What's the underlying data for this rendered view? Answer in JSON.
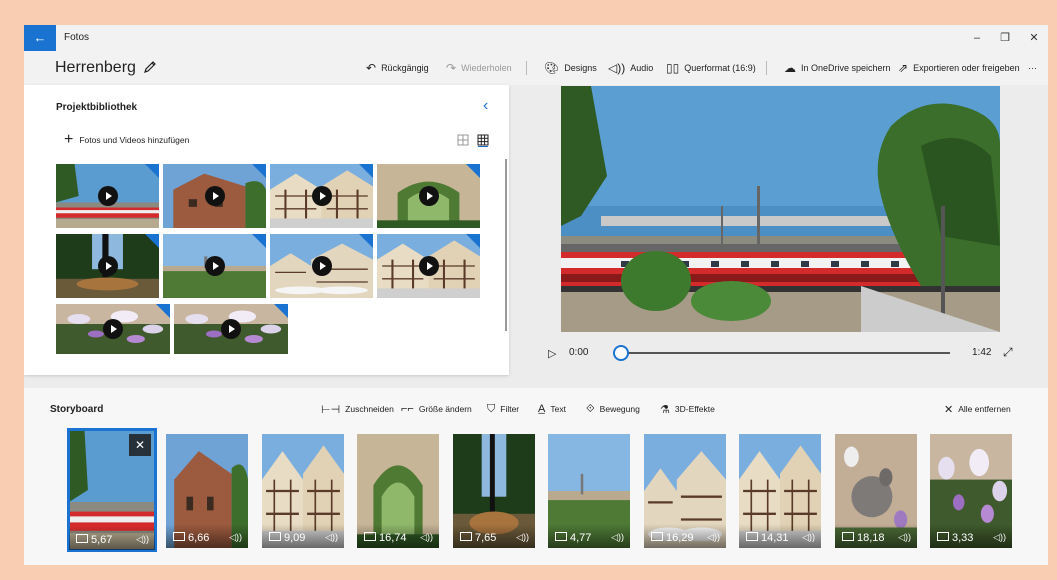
{
  "window": {
    "app_name": "Fotos",
    "back_glyph": "←",
    "minimize": "–",
    "maximize": "❐",
    "close": "✕"
  },
  "toolbar": {
    "project_title": "Herrenberg",
    "undo": "Rückgängig",
    "redo": "Wiederholen",
    "designs": "Designs",
    "audio": "Audio",
    "aspect": "Querformat (16:9)",
    "onedrive": "In OneDrive speichern",
    "export": "Exportieren oder freigeben",
    "more": "···"
  },
  "library": {
    "title": "Projektbibliothek",
    "add_label": "Fotos und Videos hinzufügen",
    "items": [
      {
        "scene": "train"
      },
      {
        "scene": "brickhouse"
      },
      {
        "scene": "halftimber"
      },
      {
        "scene": "arch"
      },
      {
        "scene": "trees"
      },
      {
        "scene": "panorama"
      },
      {
        "scene": "square"
      },
      {
        "scene": "halftimber"
      },
      {
        "scene": "flowers"
      },
      {
        "scene": "flowers"
      }
    ]
  },
  "player": {
    "current_time": "0:00",
    "total_time": "1:42",
    "progress": 0
  },
  "storyboard": {
    "title": "Storyboard",
    "tools": {
      "trim": "Zuschneiden",
      "resize": "Größe ändern",
      "filter": "Filter",
      "text": "Text",
      "motion": "Bewegung",
      "effects3d": "3D-Effekte",
      "remove_all": "Alle entfernen"
    },
    "close_glyph": "✕",
    "audio_glyph": "◁))",
    "clips": [
      {
        "duration": "5,67",
        "scene": "train",
        "selected": true
      },
      {
        "duration": "6,66",
        "scene": "brickhouse"
      },
      {
        "duration": "9,09",
        "scene": "halftimber"
      },
      {
        "duration": "16,74",
        "scene": "arch"
      },
      {
        "duration": "7,65",
        "scene": "trees"
      },
      {
        "duration": "4,77",
        "scene": "panorama"
      },
      {
        "duration": "16,29",
        "scene": "square"
      },
      {
        "duration": "14,31",
        "scene": "halftimber"
      },
      {
        "duration": "18,18",
        "scene": "pigeon"
      },
      {
        "duration": "3,33",
        "scene": "flowers"
      }
    ]
  },
  "colors": {
    "accent": "#1a73d1",
    "page_frame": "#f9cdb1",
    "window_bg": "#ececec"
  }
}
